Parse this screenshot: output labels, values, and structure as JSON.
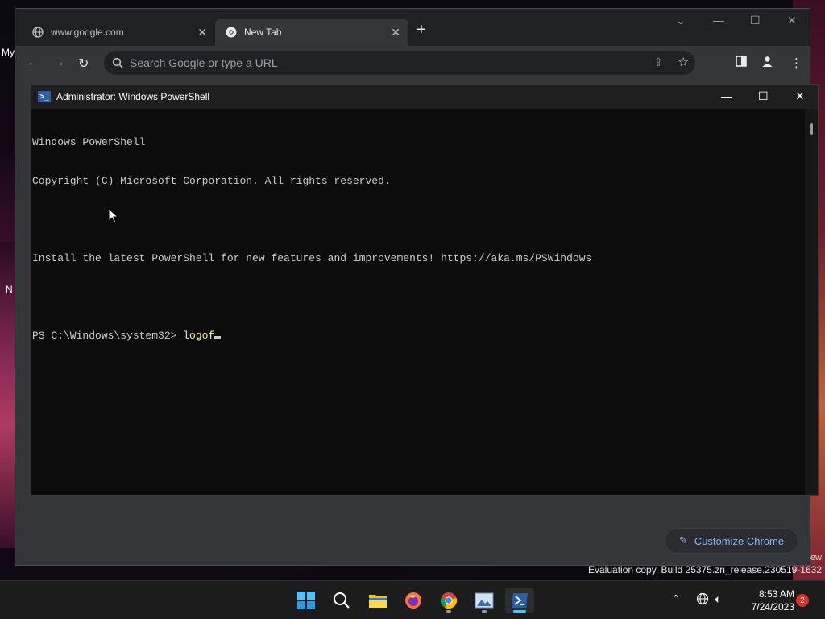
{
  "desktop": {
    "label_my": "My",
    "label_n": "N",
    "label_ew": "ew",
    "watermark": "Evaluation copy. Build 25375.zn_release.230519-1632"
  },
  "chrome": {
    "tabs": [
      {
        "title": "www.google.com",
        "active": false,
        "icon": "globe-icon"
      },
      {
        "title": "New Tab",
        "active": true,
        "icon": "chrome-icon"
      }
    ],
    "omnibox_placeholder": "Search Google or type a URL",
    "customize_label": "Customize Chrome"
  },
  "powershell": {
    "window_title": "Administrator: Windows PowerShell",
    "lines": [
      "Windows PowerShell",
      "Copyright (C) Microsoft Corporation. All rights reserved.",
      "",
      "Install the latest PowerShell for new features and improvements! https://aka.ms/PSWindows",
      ""
    ],
    "prompt": "PS C:\\Windows\\system32> ",
    "command": "logof"
  },
  "taskbar": {
    "apps": [
      "start-icon",
      "search-icon",
      "file-explorer-icon",
      "firefox-icon",
      "chrome-icon",
      "photos-icon",
      "powershell-icon"
    ],
    "time": "8:53 AM",
    "date": "7/24/2023",
    "notification_count": "2"
  },
  "colors": {
    "chrome_bg": "#35363a",
    "terminal_bg": "#0c0c0c",
    "command_text": "#f9f1a5",
    "accent": "#4cc2ff"
  }
}
